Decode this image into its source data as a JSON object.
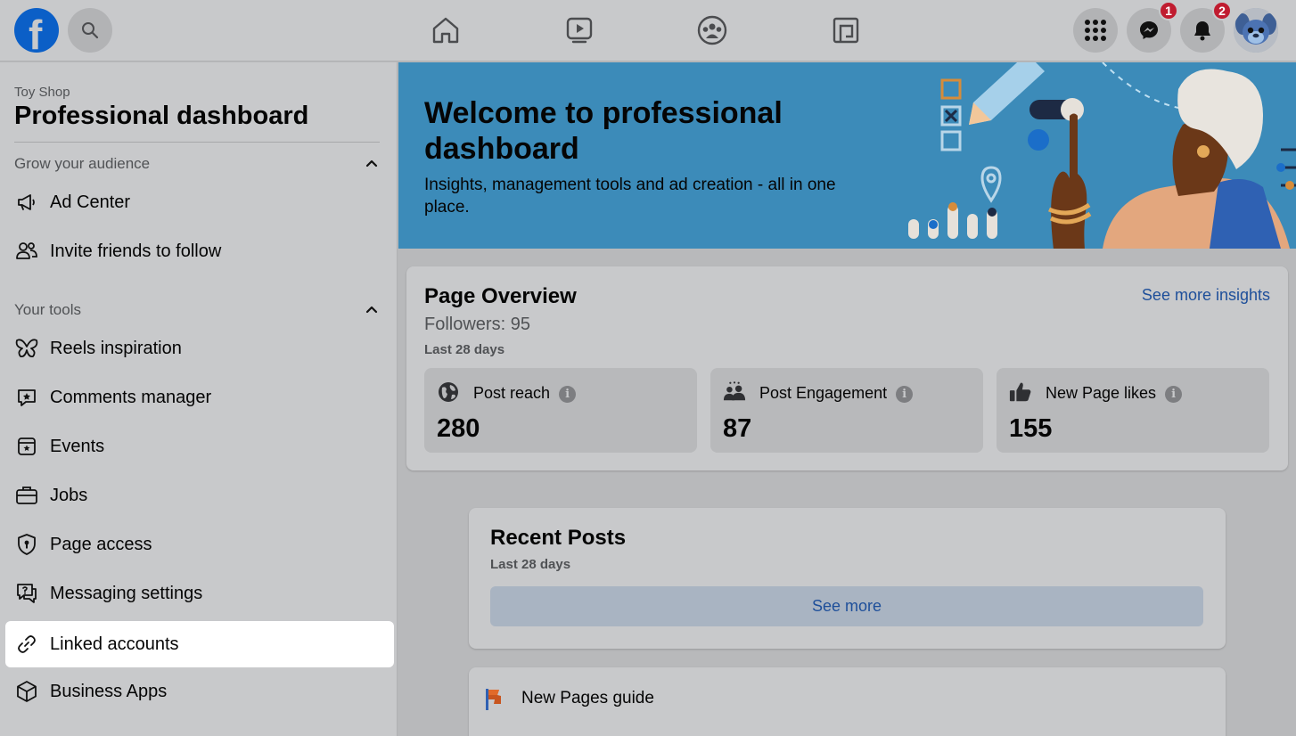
{
  "topbar": {
    "logo_letter": "f",
    "messenger_badge": "1",
    "notifications_badge": "2"
  },
  "sidebar": {
    "page_name": "Toy Shop",
    "title": "Professional dashboard",
    "sections": [
      {
        "heading": "Grow your audience"
      },
      {
        "heading": "Your tools"
      }
    ],
    "items": [
      {
        "label": "Ad Center",
        "icon": "megaphone-icon"
      },
      {
        "label": "Invite friends to follow",
        "icon": "people-icon"
      },
      {
        "label": "Reels inspiration",
        "icon": "butterfly-icon"
      },
      {
        "label": "Comments manager",
        "icon": "comment-star-icon"
      },
      {
        "label": "Events",
        "icon": "calendar-star-icon"
      },
      {
        "label": "Jobs",
        "icon": "briefcase-icon"
      },
      {
        "label": "Page access",
        "icon": "shield-icon"
      },
      {
        "label": "Messaging settings",
        "icon": "message-question-icon"
      },
      {
        "label": "Linked accounts",
        "icon": "link-icon"
      },
      {
        "label": "Business Apps",
        "icon": "cube-icon"
      }
    ]
  },
  "banner": {
    "title": "Welcome to professional dashboard",
    "subtitle": "Insights, management tools and ad creation - all in one place."
  },
  "overview": {
    "title": "Page Overview",
    "link": "See more insights",
    "followers": "Followers: 95",
    "period": "Last 28 days",
    "stats": [
      {
        "label": "Post reach",
        "value": "280",
        "icon": "globe-icon"
      },
      {
        "label": "Post Engagement",
        "value": "87",
        "icon": "group-icon"
      },
      {
        "label": "New Page likes",
        "value": "155",
        "icon": "thumbs-up-icon"
      }
    ]
  },
  "recent": {
    "title": "Recent Posts",
    "period": "Last 28 days",
    "button": "See more"
  },
  "guide": {
    "label": "New Pages guide"
  },
  "colors": {
    "accent_link": "#1e4f9a",
    "banner_bg": "#3c8bb9",
    "badge": "#c01c30"
  }
}
